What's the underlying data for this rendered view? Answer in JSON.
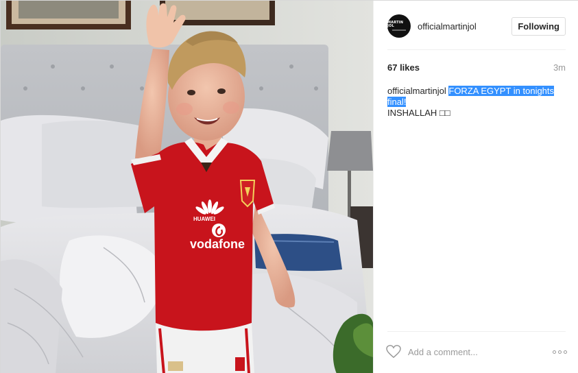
{
  "post": {
    "username": "officialmartinjol",
    "avatar_text": "MARTIN JOL",
    "follow_button": "Following",
    "likes": "67 likes",
    "time": "3m",
    "caption_user": "officialmartinjol",
    "caption_highlight": "FORZA EGYPT in tonights final!",
    "caption_line2": "INSHALLAH □□",
    "comment_placeholder": "Add a comment...",
    "icons": [
      "heart-icon",
      "more-options-icon"
    ]
  },
  "photo": {
    "shirt_sponsor": "vodafone",
    "shirt_brand": "HUAWEI",
    "colors": {
      "shirt": "#c8141c",
      "wall": "#d6d8d2",
      "bed": "#e4e4e6"
    }
  },
  "colors": {
    "selection": "#3390ff",
    "border": "#dbdbdb",
    "muted": "#999999"
  }
}
